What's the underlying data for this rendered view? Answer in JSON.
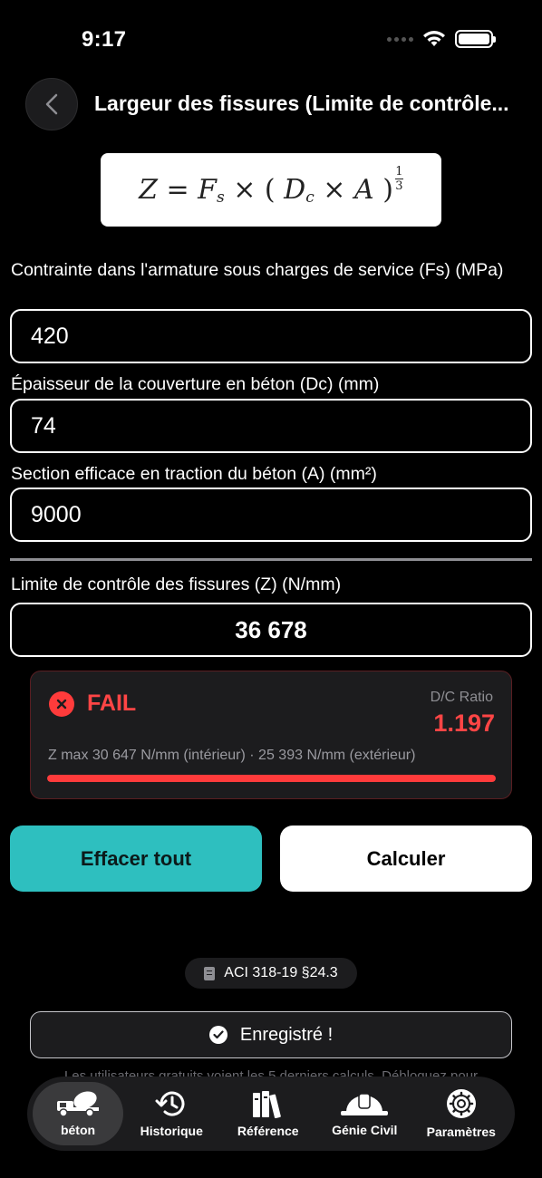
{
  "status": {
    "time": "9:17"
  },
  "header": {
    "title": "Largeur des fissures (Limite de contrôle..."
  },
  "fields": [
    {
      "label": "Contrainte dans l'armature sous charges de service (Fs) (MPa)",
      "value": "420"
    },
    {
      "label": "Épaisseur de la couverture en béton (Dc) (mm)",
      "value": "74"
    },
    {
      "label": "Section efficace en traction du béton (A) (mm²)",
      "value": "9000"
    }
  ],
  "result": {
    "label": "Limite de contrôle des fissures (Z) (N/mm)",
    "value": "36 678"
  },
  "check": {
    "status": "FAIL",
    "dc_label": "D/C Ratio",
    "dc_value": "1.197",
    "zmax_text": "Z max 30 647 N/mm (intérieur) · 25 393 N/mm (extérieur)",
    "progress_fraction": 1.0,
    "status_color": "#ff3b3b"
  },
  "buttons": {
    "clear": "Effacer tout",
    "calculate": "Calculer"
  },
  "reference": {
    "label": "ACI 318-19 §24.3"
  },
  "toast": {
    "label": "Enregistré !"
  },
  "free_note": "Les utilisateurs gratuits voient les 5 derniers calculs. Débloquez pour",
  "tabs": [
    {
      "label": "béton",
      "icon": "concrete-mixer-icon",
      "active": true
    },
    {
      "label": "Historique",
      "icon": "history-icon",
      "active": false
    },
    {
      "label": "Référence",
      "icon": "books-icon",
      "active": false
    },
    {
      "label": "Génie Civil",
      "icon": "hard-hat-icon",
      "active": false
    },
    {
      "label": "Paramètres",
      "icon": "gear-icon",
      "active": false
    }
  ],
  "colors": {
    "accent": "#2ebfbf",
    "fail": "#ff4545",
    "background": "#000000"
  }
}
